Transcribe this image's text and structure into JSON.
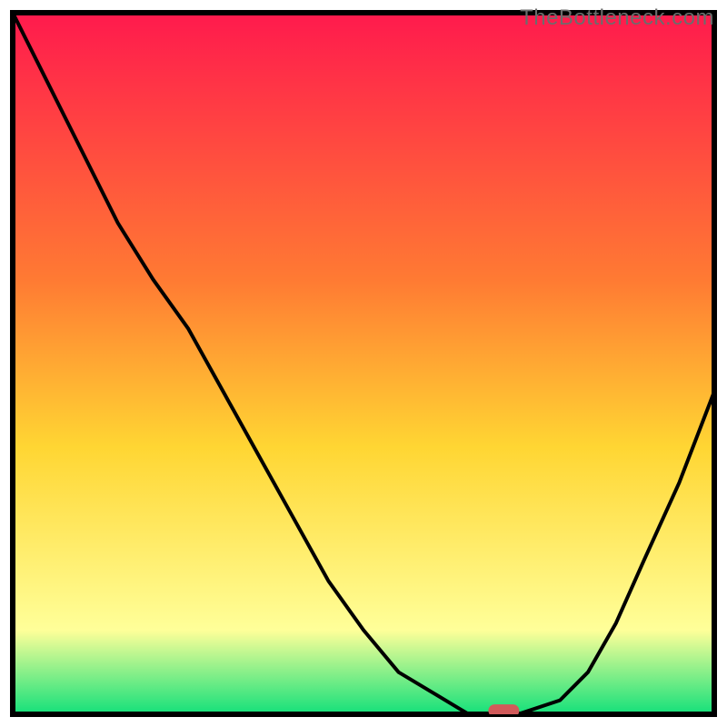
{
  "watermark": "TheBottleneck.com",
  "chart_data": {
    "type": "line",
    "title": "",
    "xlabel": "",
    "ylabel": "",
    "x": [
      0.0,
      0.05,
      0.1,
      0.15,
      0.2,
      0.25,
      0.3,
      0.35,
      0.4,
      0.45,
      0.5,
      0.55,
      0.6,
      0.65,
      0.68,
      0.72,
      0.78,
      0.82,
      0.86,
      0.9,
      0.95,
      1.0
    ],
    "values": [
      1.0,
      0.9,
      0.8,
      0.7,
      0.62,
      0.55,
      0.46,
      0.37,
      0.28,
      0.19,
      0.12,
      0.06,
      0.03,
      0.0,
      0.0,
      0.0,
      0.02,
      0.06,
      0.13,
      0.22,
      0.33,
      0.46
    ],
    "xlim": [
      0,
      1
    ],
    "ylim": [
      0,
      1
    ],
    "marker": {
      "x": 0.7,
      "y": 0.005
    },
    "background_gradient": {
      "top": "#ff1a4d",
      "mid1": "#ff7a33",
      "mid2": "#ffd633",
      "lower": "#ffff99",
      "bottom": "#13e07a"
    },
    "axes_color": "#000000",
    "line_color": "#000000",
    "marker_color": "#d15a5a"
  }
}
